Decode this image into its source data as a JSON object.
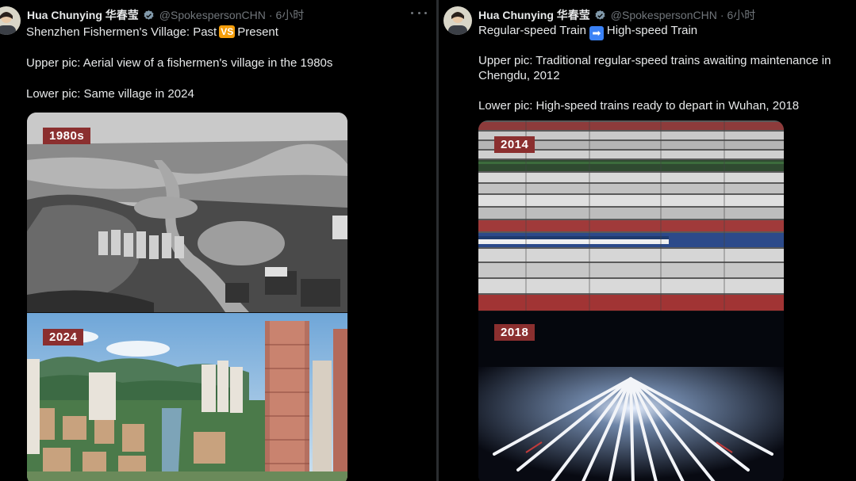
{
  "left_post": {
    "author_name": "Hua Chunying 华春莹",
    "handle": "@SpokespersonCHN",
    "separator": "·",
    "time": "6小时",
    "line1_pre": "Shenzhen Fishermen's Village: Past",
    "line1_emoji": "VS",
    "line1_post": "Present",
    "line2": "Upper pic: Aerial view of a fishermen's village in the 1980s",
    "line3": "Lower pic: Same village in 2024",
    "upper_label": "1980s",
    "lower_label": "2024"
  },
  "right_post": {
    "author_name": "Hua Chunying 华春莹",
    "handle": "@SpokespersonCHN",
    "separator": "·",
    "time": "6小时",
    "line1_pre": "Regular-speed Train",
    "line1_emoji": "➡",
    "line1_post": "High-speed Train",
    "line2": "Upper pic: Traditional regular-speed trains awaiting maintenance in Chengdu, 2012",
    "line3": "Lower pic: High-speed trains ready to depart in Wuhan, 2018",
    "upper_label": "2014",
    "lower_label": "2018"
  },
  "icons": {
    "verified": "verified-badge-icon",
    "more": "more-options-icon"
  },
  "colors": {
    "background": "#000000",
    "label_bg": "#8b2f2f",
    "verified": "#829aab",
    "muted": "#71767b"
  }
}
